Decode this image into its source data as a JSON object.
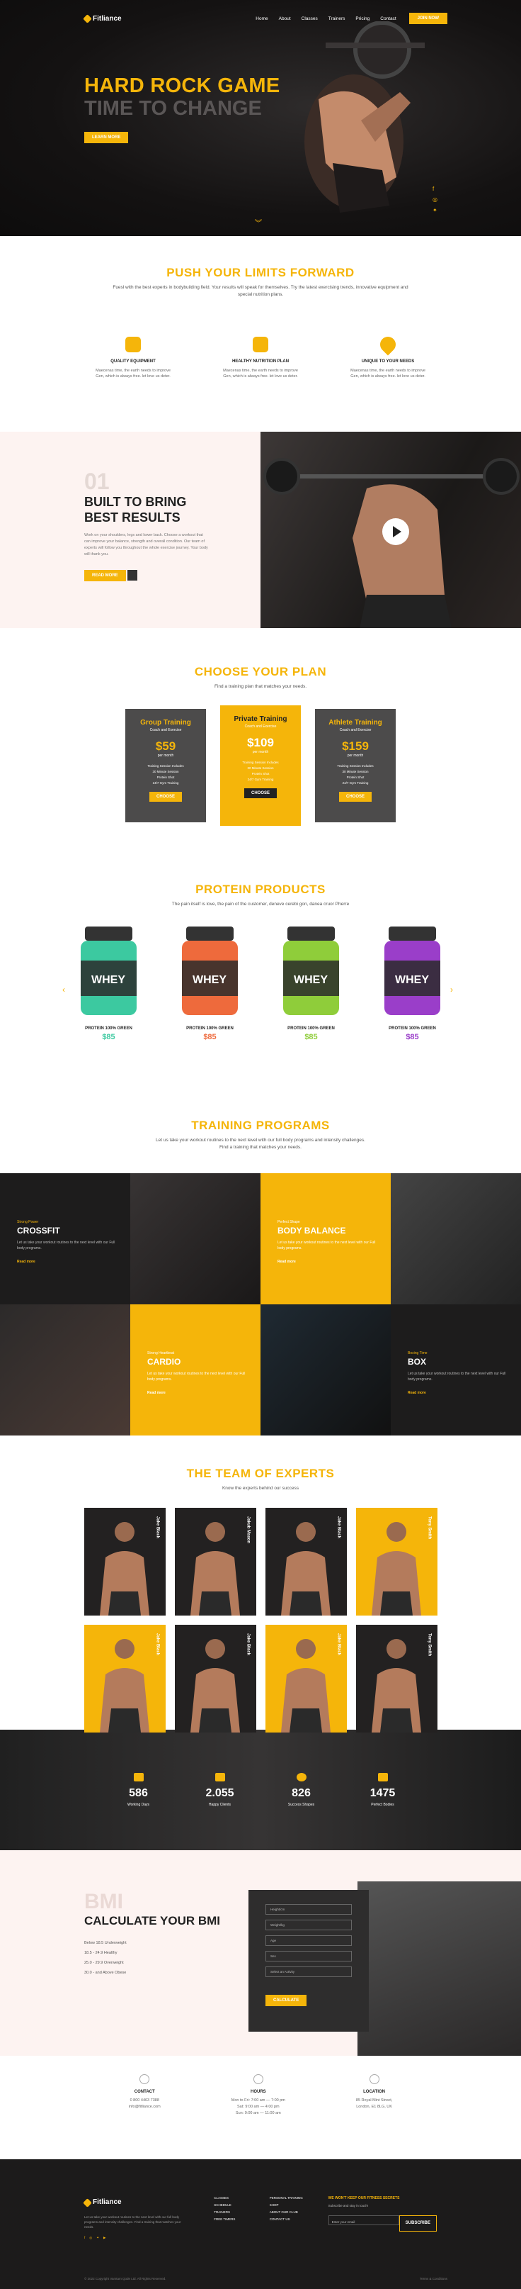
{
  "nav": {
    "logo": "Fitliance",
    "items": [
      "Home",
      "About",
      "Classes",
      "Trainers",
      "Pricing",
      "Contact"
    ],
    "cta": "Join Now"
  },
  "hero": {
    "title1": "HARD ROCK GAME",
    "title2": "TIME TO CHANGE",
    "button": "Learn more"
  },
  "push": {
    "title": "PUSH YOUR LIMITS FORWARD",
    "subtitle": "Fuesl with the best experts in bodybuilding field. Your results will speak for themselves. Try the latest exercising trends, innovative equipment and special nutrition plans.",
    "features": [
      {
        "title": "Quality Equipment",
        "text": "Maecenas time, the earth needs to improve Gen, which is always free. let love us deter."
      },
      {
        "title": "Healthy Nutrition Plan",
        "text": "Maecenas time, the earth needs to improve Gen, which is always free. let love us deter."
      },
      {
        "title": "Unique to your needs",
        "text": "Maecenas time, the earth needs to improve Gen, which is always free. let love us deter."
      }
    ]
  },
  "built": {
    "num": "01",
    "title1": "BUILT TO BRING",
    "title2": "BEST RESULTS",
    "text": "Work on your shoulders, legs and lower back. Choose a workout that can improve your balance, strength and overall condition. Our team of experts will follow you throughout the whole exercise journey. Your body will thank you.",
    "button": "Read more"
  },
  "plan": {
    "title": "CHOOSE YOUR PLAN",
    "subtitle": "Find a training plan that matches your needs.",
    "plans": [
      {
        "name": "Group Training",
        "sub": "Coach and Exercise",
        "price": "$59",
        "per": "per month",
        "lines": [
          "Training Session Includes",
          "30 Minute Session",
          "Protein Shot",
          "24/7 Gym Training"
        ],
        "button": "Choose"
      },
      {
        "name": "Private Training",
        "sub": "Coach and Exercise",
        "price": "$109",
        "per": "per month",
        "lines": [
          "Training Session Includes",
          "30 Minute Session",
          "Protein Shot",
          "24/7 Gym Training"
        ],
        "button": "Choose"
      },
      {
        "name": "Athlete Training",
        "sub": "Coach and Exercise",
        "price": "$159",
        "per": "per month",
        "lines": [
          "Training Session Includes",
          "30 Minute Session",
          "Protein Shot",
          "24/7 Gym Training"
        ],
        "button": "Choose"
      }
    ]
  },
  "protein": {
    "title": "PROTEIN PRODUCTS",
    "subtitle": "The pain itself is love, the pain of the customer, deneve cerebi gon, danea cruor Pherre",
    "products": [
      {
        "name": "PROTEIN 100% GREEN",
        "price": "$85",
        "color": "#3cc9a0",
        "priceColor": "#3cc9a0",
        "label": "WHEY"
      },
      {
        "name": "PROTEIN 100% GREEN",
        "price": "$85",
        "color": "#ee6a3c",
        "priceColor": "#ee6a3c",
        "label": "WHEY"
      },
      {
        "name": "PROTEIN 100% GREEN",
        "price": "$85",
        "color": "#8fcd3a",
        "priceColor": "#8fcd3a",
        "label": "WHEY"
      },
      {
        "name": "PROTEIN 100% GREEN",
        "price": "$85",
        "color": "#9a3ec9",
        "priceColor": "#9a3ec9",
        "label": "WHEY"
      }
    ]
  },
  "training": {
    "title": "TRAINING PROGRAMS",
    "subtitle1": "Let us take your workout routines to the next level with our full body programs and intensity challenges.",
    "subtitle2": "Find a training that matches your needs.",
    "cells": [
      {
        "small": "Strong Power",
        "name": "CROSSFIT",
        "text": "Let us take your workout routines to the next level with our Full body programs.",
        "more": "Read more"
      },
      {
        "small": "Perfect Shape",
        "name": "BODY BALANCE",
        "text": "Let us take your workout routines to the next level with our Full body programs.",
        "more": "Read more"
      },
      {
        "small": "Strong Heartbeat",
        "name": "CARDIO",
        "text": "Let us take your workout routines to the next level with our Full body programs.",
        "more": "Read more"
      },
      {
        "small": "Boxing Time",
        "name": "BOX",
        "text": "Let us take your workout routines to the next level with our Full body programs.",
        "more": "Read more"
      }
    ]
  },
  "team": {
    "title": "THE TEAM OF EXPERTS",
    "subtitle": "Know the experts behind our success",
    "members": [
      "Jake Black",
      "Jakub Mason",
      "Jake Black",
      "Tony Smith",
      "Jake Black",
      "Jake Black",
      "Jake Black",
      "Tony Smith"
    ]
  },
  "stats": [
    {
      "num": "586",
      "label": "Working Days"
    },
    {
      "num": "2.055",
      "label": "Happy Clients"
    },
    {
      "num": "826",
      "label": "Success Shapes"
    },
    {
      "num": "1475",
      "label": "Perfect Bodies"
    }
  ],
  "bmi": {
    "big": "BMI",
    "title": "CALCULATE YOUR BMI",
    "list": [
      "Below 18.5 Underweight",
      "18.5 - 24.9 Healthy",
      "25.0 - 29.9 Overweight",
      "30.0 - and Above Obese"
    ],
    "fields": [
      "Height/cm",
      "Weight/kg",
      "Age",
      "Sex",
      "Select an Activity"
    ],
    "button": "Calculate"
  },
  "contact": [
    {
      "title": "CONTACT",
      "lines": [
        "0 800 4463 7388",
        "info@fitliance.com"
      ]
    },
    {
      "title": "HOURS",
      "lines": [
        "Mon to Fri: 7:00 am — 7:00 pm",
        "Sat: 9:00 am — 4:00 pm",
        "Sun: 9:00 am — 11:00 am"
      ]
    },
    {
      "title": "LOCATION",
      "lines": [
        "85 Royal Mint Street,",
        "London, E1 8LG, UK"
      ]
    }
  ],
  "footer": {
    "logo": "Fitliance",
    "about": "Let us take your workout routines to the next level with our full body programs and intensity challenges. Find a training that matches your needs.",
    "col2": [
      "CLASSES",
      "SCHEDULE",
      "TRAINERS",
      "FREE TIMERS"
    ],
    "col3": [
      "PERSONAL TRAINING",
      "SHOP",
      "ABOUT OUR CLUB",
      "CONTACT US"
    ],
    "newsTitle": "WE WON'T KEEP OUR FITNESS SECRETS",
    "newsSub": "Subscribe and stay in touch!",
    "placeholder": "Enter your email",
    "subscribe": "Subscribe",
    "copyright": "© 2022 Copyright Vamtam Qode Ltd. All Rights Reserved.",
    "terms": "Terms & Conditions"
  }
}
